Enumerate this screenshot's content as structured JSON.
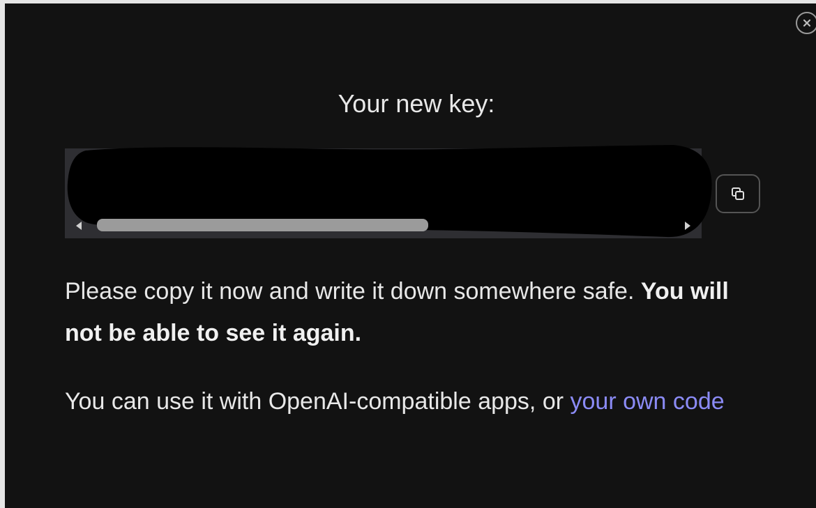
{
  "dialog": {
    "title": "Your new key:",
    "key_value": "",
    "copy_icon": "copy-icon",
    "close_icon": "close-icon",
    "message_prefix": "Please copy it now and write it down somewhere safe. ",
    "message_bold": "You will not be able to see it again.",
    "usage_text": "You can use it with OpenAI-compatible apps, or ",
    "usage_link": "your own code"
  },
  "colors": {
    "background": "#121212",
    "text": "#e8e8e8",
    "link": "#8b8bf5",
    "key_box": "#2e2e32"
  }
}
